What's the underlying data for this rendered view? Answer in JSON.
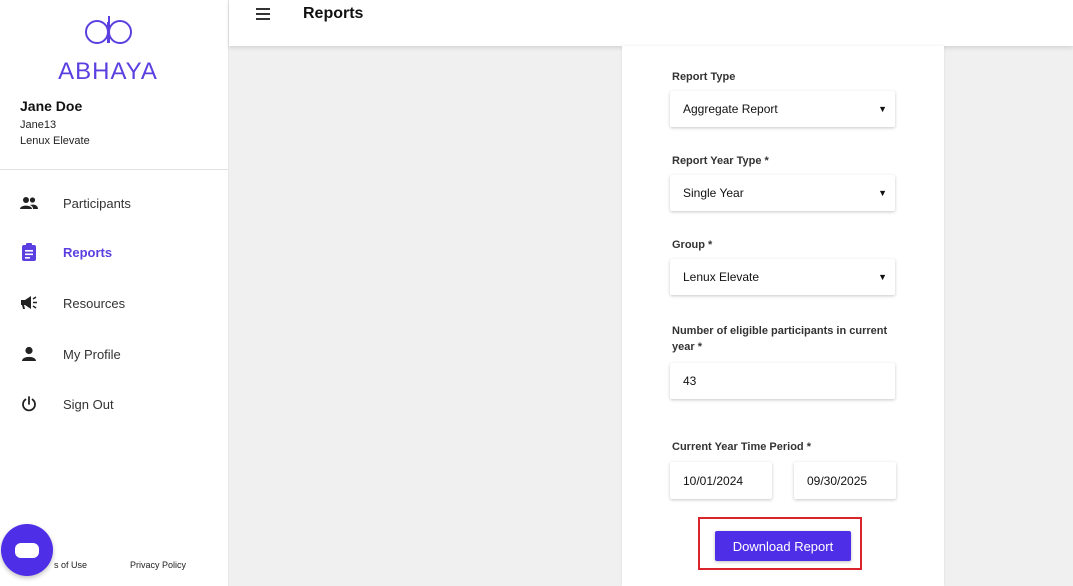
{
  "brand": {
    "name": "ABHAYA",
    "color": "#5b3fe0"
  },
  "user": {
    "name": "Jane Doe",
    "username": "Jane13",
    "organization": "Lenux Elevate"
  },
  "sidebar": {
    "items": [
      {
        "label": "Participants",
        "icon": "people-icon",
        "active": false
      },
      {
        "label": "Reports",
        "icon": "clipboard-icon",
        "active": true
      },
      {
        "label": "Resources",
        "icon": "megaphone-icon",
        "active": false
      },
      {
        "label": "My Profile",
        "icon": "person-icon",
        "active": false
      },
      {
        "label": "Sign Out",
        "icon": "power-icon",
        "active": false
      }
    ],
    "footer": {
      "terms": "s of Use",
      "privacy": "Privacy Policy"
    }
  },
  "header": {
    "title": "Reports"
  },
  "form": {
    "report_type": {
      "label": "Report Type",
      "value": "Aggregate Report"
    },
    "year_type": {
      "label": "Report Year Type *",
      "value": "Single Year"
    },
    "group": {
      "label": "Group *",
      "value": "Lenux Elevate"
    },
    "eligible": {
      "label": "Number of eligible participants in current year *",
      "value": "43"
    },
    "period": {
      "label": "Current Year Time Period *",
      "start": "10/01/2024",
      "end": "09/30/2025"
    },
    "download_label": "Download Report"
  },
  "colors": {
    "accent": "#4f2ee8",
    "highlight": "#d9232d"
  }
}
